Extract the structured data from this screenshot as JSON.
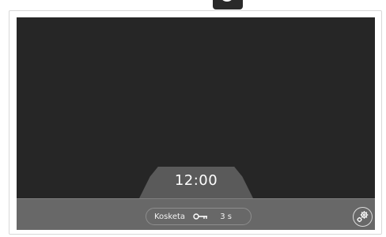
{
  "header": {
    "badge_icon": "power-ring-icon"
  },
  "display": {
    "time": "12:00"
  },
  "bottom_bar": {
    "lock": {
      "label": "Kosketa",
      "icon": "key-icon",
      "duration": "3 s"
    },
    "settings_icon": "settings-gears-icon"
  },
  "colors": {
    "screen": "#262626",
    "bar": "#686868",
    "tab": "#5a5a5a",
    "text": "#ffffff"
  }
}
